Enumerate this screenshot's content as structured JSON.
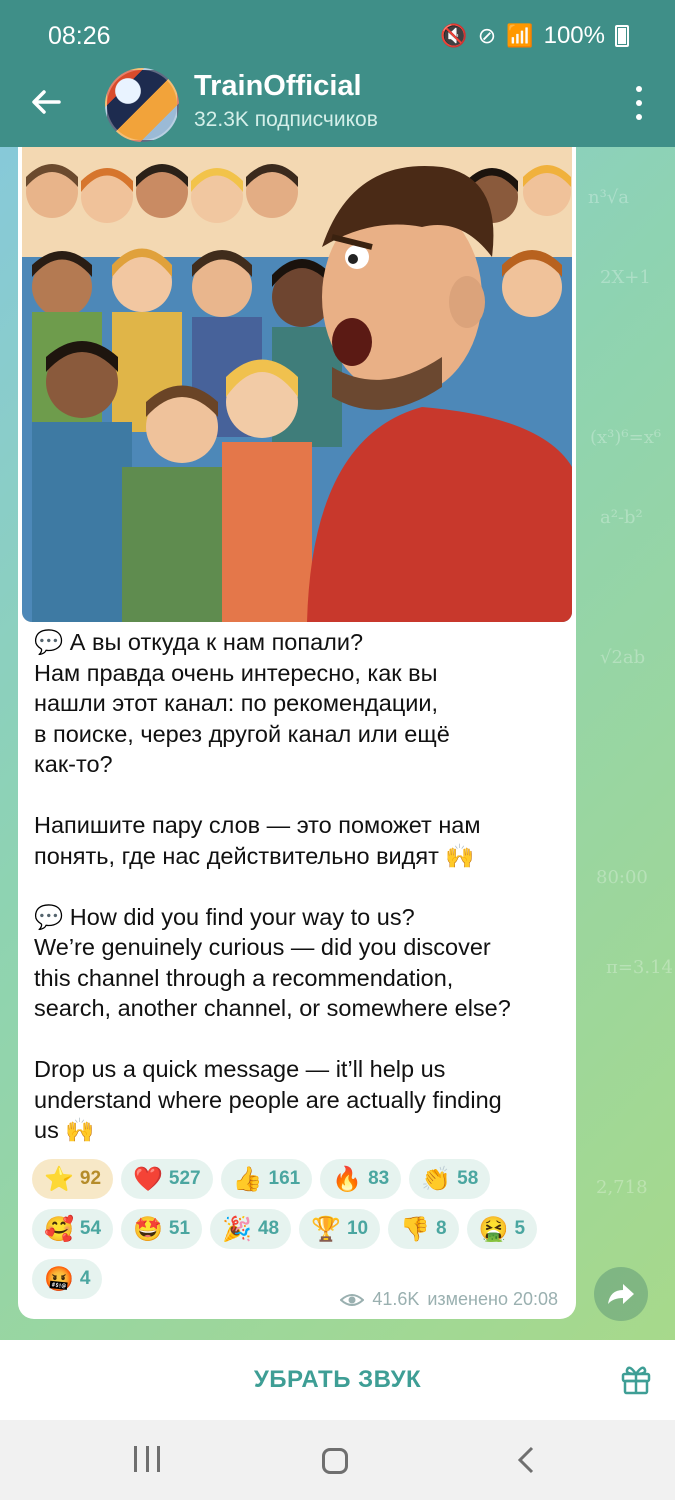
{
  "status_bar": {
    "time": "08:26",
    "battery": "100%",
    "icons": [
      "mute-icon",
      "do-not-disturb-icon",
      "network-4g-icon",
      "signal-icon",
      "battery-icon"
    ]
  },
  "header": {
    "title": "TrainOfficial",
    "subtitle": "32.3K подписчиков",
    "background_color": "#3f8f88"
  },
  "message": {
    "illustration": "cartoon-crowd-shouting-man",
    "text": "💬 А вы откуда к нам попали?\nНам правда очень интересно, как вы\nнашли этот канал: по рекомендации,\nв поиске, через другой канал или ещё\nкак-то?\n\nНапишите пару слов — это поможет нам\nпонять, где нас действительно видят 🙌\n\n💬 How did you find your way to us?\nWe’re genuinely curious — did you discover\nthis channel through a recommendation,\nsearch, another channel, or somewhere else?\n\nDrop us a quick message — it’ll help us\nunderstand where people are actually finding\nus 🙌",
    "reactions": [
      {
        "emoji": "⭐",
        "count": "92",
        "selected": true
      },
      {
        "emoji": "❤️",
        "count": "527"
      },
      {
        "emoji": "👍",
        "count": "161"
      },
      {
        "emoji": "🔥",
        "count": "83"
      },
      {
        "emoji": "👏",
        "count": "58"
      },
      {
        "emoji": "🥰",
        "count": "54"
      },
      {
        "emoji": "🤩",
        "count": "51"
      },
      {
        "emoji": "🎉",
        "count": "48"
      },
      {
        "emoji": "🏆",
        "count": "10"
      },
      {
        "emoji": "👎",
        "count": "8"
      },
      {
        "emoji": "🤮",
        "count": "5"
      },
      {
        "emoji": "🤬",
        "count": "4"
      }
    ],
    "views": "41.6K",
    "edited": "изменено 20:08"
  },
  "bottom_bar": {
    "unmute_label": "УБРАТЬ ЗВУК",
    "accent": "#3e9e95"
  }
}
